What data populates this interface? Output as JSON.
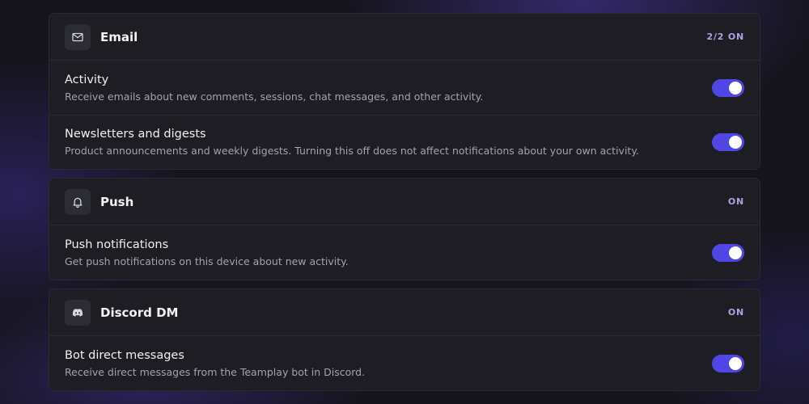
{
  "sections": [
    {
      "title": "Email",
      "status": "2/2 ON",
      "icon": "mail-icon",
      "items": [
        {
          "title": "Activity",
          "description": "Receive emails about new comments, sessions, chat messages, and other activity.",
          "enabled": true
        },
        {
          "title": "Newsletters and digests",
          "description": "Product announcements and weekly digests. Turning this off does not affect notifications about your own activity.",
          "enabled": true
        }
      ]
    },
    {
      "title": "Push",
      "status": "ON",
      "icon": "bell-icon",
      "items": [
        {
          "title": "Push notifications",
          "description": "Get push notifications on this device about new activity.",
          "enabled": true
        }
      ]
    },
    {
      "title": "Discord DM",
      "status": "ON",
      "icon": "discord-icon",
      "items": [
        {
          "title": "Bot direct messages",
          "description": "Receive direct messages from the Teamplay bot in Discord.",
          "enabled": true
        }
      ]
    }
  ],
  "colors": {
    "accent": "#4f46e5",
    "status_text": "#a9a4e6",
    "card_bg": "#1d1d23"
  }
}
